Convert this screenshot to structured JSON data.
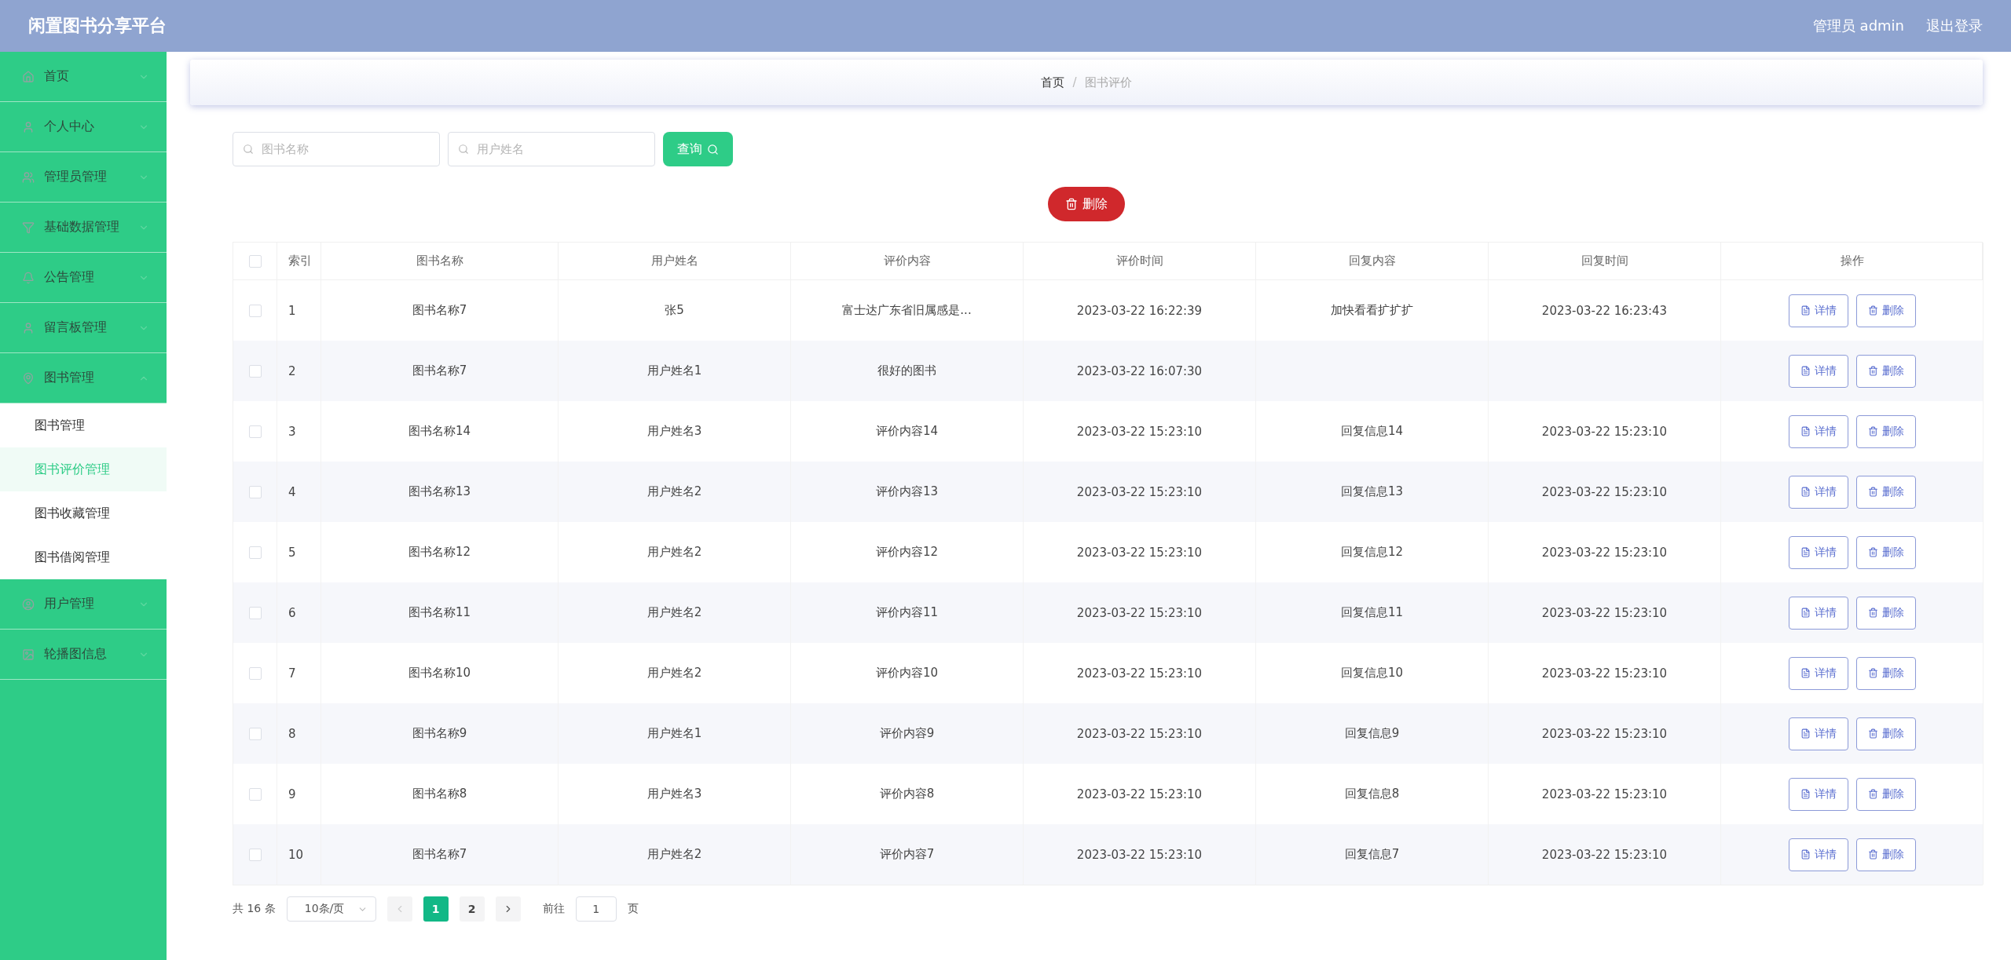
{
  "header": {
    "title": "闲置图书分享平台",
    "user": "管理员 admin",
    "logout": "退出登录"
  },
  "sidebar": {
    "items": [
      {
        "label": "首页",
        "expanded": false
      },
      {
        "label": "个人中心",
        "expanded": false
      },
      {
        "label": "管理员管理",
        "expanded": false
      },
      {
        "label": "基础数据管理",
        "expanded": false
      },
      {
        "label": "公告管理",
        "expanded": false
      },
      {
        "label": "留言板管理",
        "expanded": false
      },
      {
        "label": "图书管理",
        "expanded": true,
        "children": [
          {
            "label": "图书管理",
            "selected": false
          },
          {
            "label": "图书评价管理",
            "selected": true
          },
          {
            "label": "图书收藏管理",
            "selected": false
          },
          {
            "label": "图书借阅管理",
            "selected": false
          }
        ]
      },
      {
        "label": "用户管理",
        "expanded": false
      },
      {
        "label": "轮播图信息",
        "expanded": false
      }
    ]
  },
  "breadcrumb": {
    "separator": "/",
    "items": [
      "首页",
      "图书评价"
    ]
  },
  "search": {
    "fields": [
      {
        "placeholder": "图书名称"
      },
      {
        "placeholder": "用户姓名"
      }
    ],
    "button": "查询"
  },
  "delete_button": "删除",
  "table": {
    "select_all_checked": false,
    "columns": [
      "索引",
      "图书名称",
      "用户姓名",
      "评价内容",
      "评价时间",
      "回复内容",
      "回复时间",
      "操作"
    ],
    "rows": [
      {
        "checked": false,
        "cells": [
          "1",
          "图书名称7",
          "张5",
          "富士达广东省旧属感是...",
          "2023-03-22 16:22:39",
          "加快看看扩扩扩",
          "2023-03-22 16:23:43"
        ],
        "actions": [
          "详情",
          "删除"
        ]
      },
      {
        "checked": false,
        "cells": [
          "2",
          "图书名称7",
          "用户姓名1",
          "很好的图书",
          "2023-03-22 16:07:30"
        ],
        "actions": [
          "详情",
          "删除"
        ]
      },
      {
        "checked": false,
        "cells": [
          "3",
          "图书名称14",
          "用户姓名3",
          "评价内容14",
          "2023-03-22 15:23:10",
          "回复信息14",
          "2023-03-22 15:23:10"
        ],
        "actions": [
          "详情",
          "删除"
        ]
      },
      {
        "checked": false,
        "cells": [
          "4",
          "图书名称13",
          "用户姓名2",
          "评价内容13",
          "2023-03-22 15:23:10",
          "回复信息13",
          "2023-03-22 15:23:10"
        ],
        "actions": [
          "详情",
          "删除"
        ]
      },
      {
        "checked": false,
        "cells": [
          "5",
          "图书名称12",
          "用户姓名2",
          "评价内容12",
          "2023-03-22 15:23:10",
          "回复信息12",
          "2023-03-22 15:23:10"
        ],
        "actions": [
          "详情",
          "删除"
        ]
      },
      {
        "checked": false,
        "cells": [
          "6",
          "图书名称11",
          "用户姓名2",
          "评价内容11",
          "2023-03-22 15:23:10",
          "回复信息11",
          "2023-03-22 15:23:10"
        ],
        "actions": [
          "详情",
          "删除"
        ]
      },
      {
        "checked": false,
        "cells": [
          "7",
          "图书名称10",
          "用户姓名2",
          "评价内容10",
          "2023-03-22 15:23:10",
          "回复信息10",
          "2023-03-22 15:23:10"
        ],
        "actions": [
          "详情",
          "删除"
        ]
      },
      {
        "checked": false,
        "cells": [
          "8",
          "图书名称9",
          "用户姓名1",
          "评价内容9",
          "2023-03-22 15:23:10",
          "回复信息9",
          "2023-03-22 15:23:10"
        ],
        "actions": [
          "详情",
          "删除"
        ]
      },
      {
        "checked": false,
        "cells": [
          "9",
          "图书名称8",
          "用户姓名3",
          "评价内容8",
          "2023-03-22 15:23:10",
          "回复信息8",
          "2023-03-22 15:23:10"
        ],
        "actions": [
          "详情",
          "删除"
        ]
      },
      {
        "checked": false,
        "cells": [
          "10",
          "图书名称7",
          "用户姓名2",
          "评价内容7",
          "2023-03-22 15:23:10",
          "回复信息7",
          "2023-03-22 15:23:10"
        ],
        "actions": [
          "详情",
          "删除"
        ]
      }
    ]
  },
  "pagination": {
    "total": "共 16 条",
    "page_size": "10条/页",
    "pages": [
      {
        "label": "1",
        "selected": true
      },
      {
        "label": "2",
        "selected": false
      }
    ],
    "goto_label": "前往",
    "goto_value": "1",
    "goto_suffix": "页"
  }
}
